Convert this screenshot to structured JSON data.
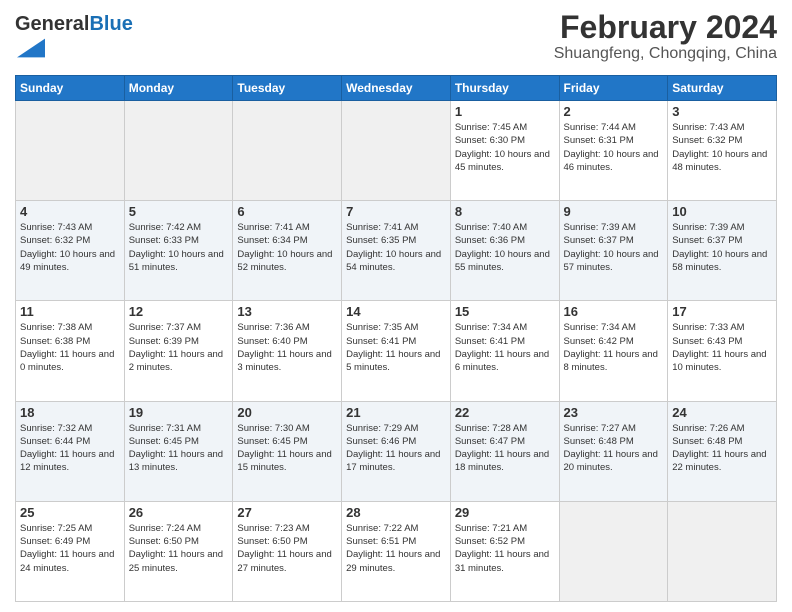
{
  "logo": {
    "text_general": "General",
    "text_blue": "Blue"
  },
  "header": {
    "month": "February 2024",
    "location": "Shuangfeng, Chongqing, China"
  },
  "days_of_week": [
    "Sunday",
    "Monday",
    "Tuesday",
    "Wednesday",
    "Thursday",
    "Friday",
    "Saturday"
  ],
  "weeks": [
    [
      {
        "day": "",
        "sunrise": "",
        "sunset": "",
        "daylight": ""
      },
      {
        "day": "",
        "sunrise": "",
        "sunset": "",
        "daylight": ""
      },
      {
        "day": "",
        "sunrise": "",
        "sunset": "",
        "daylight": ""
      },
      {
        "day": "",
        "sunrise": "",
        "sunset": "",
        "daylight": ""
      },
      {
        "day": "1",
        "sunrise": "Sunrise: 7:45 AM",
        "sunset": "Sunset: 6:30 PM",
        "daylight": "Daylight: 10 hours and 45 minutes."
      },
      {
        "day": "2",
        "sunrise": "Sunrise: 7:44 AM",
        "sunset": "Sunset: 6:31 PM",
        "daylight": "Daylight: 10 hours and 46 minutes."
      },
      {
        "day": "3",
        "sunrise": "Sunrise: 7:43 AM",
        "sunset": "Sunset: 6:32 PM",
        "daylight": "Daylight: 10 hours and 48 minutes."
      }
    ],
    [
      {
        "day": "4",
        "sunrise": "Sunrise: 7:43 AM",
        "sunset": "Sunset: 6:32 PM",
        "daylight": "Daylight: 10 hours and 49 minutes."
      },
      {
        "day": "5",
        "sunrise": "Sunrise: 7:42 AM",
        "sunset": "Sunset: 6:33 PM",
        "daylight": "Daylight: 10 hours and 51 minutes."
      },
      {
        "day": "6",
        "sunrise": "Sunrise: 7:41 AM",
        "sunset": "Sunset: 6:34 PM",
        "daylight": "Daylight: 10 hours and 52 minutes."
      },
      {
        "day": "7",
        "sunrise": "Sunrise: 7:41 AM",
        "sunset": "Sunset: 6:35 PM",
        "daylight": "Daylight: 10 hours and 54 minutes."
      },
      {
        "day": "8",
        "sunrise": "Sunrise: 7:40 AM",
        "sunset": "Sunset: 6:36 PM",
        "daylight": "Daylight: 10 hours and 55 minutes."
      },
      {
        "day": "9",
        "sunrise": "Sunrise: 7:39 AM",
        "sunset": "Sunset: 6:37 PM",
        "daylight": "Daylight: 10 hours and 57 minutes."
      },
      {
        "day": "10",
        "sunrise": "Sunrise: 7:39 AM",
        "sunset": "Sunset: 6:37 PM",
        "daylight": "Daylight: 10 hours and 58 minutes."
      }
    ],
    [
      {
        "day": "11",
        "sunrise": "Sunrise: 7:38 AM",
        "sunset": "Sunset: 6:38 PM",
        "daylight": "Daylight: 11 hours and 0 minutes."
      },
      {
        "day": "12",
        "sunrise": "Sunrise: 7:37 AM",
        "sunset": "Sunset: 6:39 PM",
        "daylight": "Daylight: 11 hours and 2 minutes."
      },
      {
        "day": "13",
        "sunrise": "Sunrise: 7:36 AM",
        "sunset": "Sunset: 6:40 PM",
        "daylight": "Daylight: 11 hours and 3 minutes."
      },
      {
        "day": "14",
        "sunrise": "Sunrise: 7:35 AM",
        "sunset": "Sunset: 6:41 PM",
        "daylight": "Daylight: 11 hours and 5 minutes."
      },
      {
        "day": "15",
        "sunrise": "Sunrise: 7:34 AM",
        "sunset": "Sunset: 6:41 PM",
        "daylight": "Daylight: 11 hours and 6 minutes."
      },
      {
        "day": "16",
        "sunrise": "Sunrise: 7:34 AM",
        "sunset": "Sunset: 6:42 PM",
        "daylight": "Daylight: 11 hours and 8 minutes."
      },
      {
        "day": "17",
        "sunrise": "Sunrise: 7:33 AM",
        "sunset": "Sunset: 6:43 PM",
        "daylight": "Daylight: 11 hours and 10 minutes."
      }
    ],
    [
      {
        "day": "18",
        "sunrise": "Sunrise: 7:32 AM",
        "sunset": "Sunset: 6:44 PM",
        "daylight": "Daylight: 11 hours and 12 minutes."
      },
      {
        "day": "19",
        "sunrise": "Sunrise: 7:31 AM",
        "sunset": "Sunset: 6:45 PM",
        "daylight": "Daylight: 11 hours and 13 minutes."
      },
      {
        "day": "20",
        "sunrise": "Sunrise: 7:30 AM",
        "sunset": "Sunset: 6:45 PM",
        "daylight": "Daylight: 11 hours and 15 minutes."
      },
      {
        "day": "21",
        "sunrise": "Sunrise: 7:29 AM",
        "sunset": "Sunset: 6:46 PM",
        "daylight": "Daylight: 11 hours and 17 minutes."
      },
      {
        "day": "22",
        "sunrise": "Sunrise: 7:28 AM",
        "sunset": "Sunset: 6:47 PM",
        "daylight": "Daylight: 11 hours and 18 minutes."
      },
      {
        "day": "23",
        "sunrise": "Sunrise: 7:27 AM",
        "sunset": "Sunset: 6:48 PM",
        "daylight": "Daylight: 11 hours and 20 minutes."
      },
      {
        "day": "24",
        "sunrise": "Sunrise: 7:26 AM",
        "sunset": "Sunset: 6:48 PM",
        "daylight": "Daylight: 11 hours and 22 minutes."
      }
    ],
    [
      {
        "day": "25",
        "sunrise": "Sunrise: 7:25 AM",
        "sunset": "Sunset: 6:49 PM",
        "daylight": "Daylight: 11 hours and 24 minutes."
      },
      {
        "day": "26",
        "sunrise": "Sunrise: 7:24 AM",
        "sunset": "Sunset: 6:50 PM",
        "daylight": "Daylight: 11 hours and 25 minutes."
      },
      {
        "day": "27",
        "sunrise": "Sunrise: 7:23 AM",
        "sunset": "Sunset: 6:50 PM",
        "daylight": "Daylight: 11 hours and 27 minutes."
      },
      {
        "day": "28",
        "sunrise": "Sunrise: 7:22 AM",
        "sunset": "Sunset: 6:51 PM",
        "daylight": "Daylight: 11 hours and 29 minutes."
      },
      {
        "day": "29",
        "sunrise": "Sunrise: 7:21 AM",
        "sunset": "Sunset: 6:52 PM",
        "daylight": "Daylight: 11 hours and 31 minutes."
      },
      {
        "day": "",
        "sunrise": "",
        "sunset": "",
        "daylight": ""
      },
      {
        "day": "",
        "sunrise": "",
        "sunset": "",
        "daylight": ""
      }
    ]
  ]
}
